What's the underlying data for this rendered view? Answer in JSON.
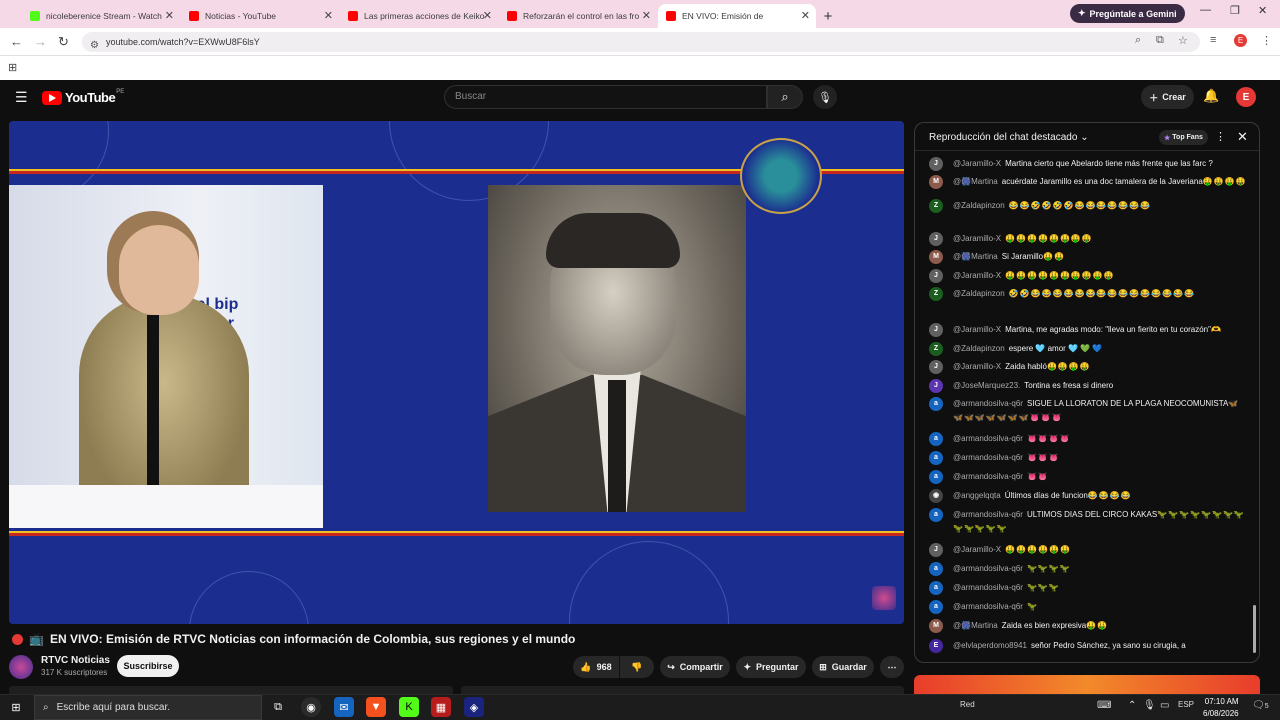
{
  "browser": {
    "tabs": [
      {
        "title": "nicoleberenice Stream - Watch",
        "color": "#53fc18"
      },
      {
        "title": "Noticias - YouTube",
        "color": "#ff0000"
      },
      {
        "title": "Las primeras acciones de Keiko",
        "color": "#ff0000"
      },
      {
        "title": "Reforzarán el control en las fro",
        "color": "#ff0000"
      },
      {
        "title": "EN VIVO: Emisión de",
        "color": "#ff0000"
      }
    ],
    "gemini": "Pregúntale a Gemini",
    "url": "youtube.com/watch?v=EXWwU8F6lsY",
    "profile": "E"
  },
  "youtube": {
    "logo": "YouTube",
    "region": "PE",
    "search_placeholder": "Buscar",
    "create": "Crear",
    "avatar": "E",
    "video": {
      "wall_text_1": "Del bip",
      "wall_text_2": "al Frer",
      "title": "EN VIVO: Emisión de RTVC Noticias con información de Colombia, sus regiones y el mundo",
      "channel": "RTVC Noticias",
      "subscribers": "317 K suscriptores",
      "subscribe": "Suscribirse",
      "likes": "968",
      "share": "Compartir",
      "ask": "Preguntar",
      "save": "Guardar"
    }
  },
  "chat": {
    "title": "Reproducción del chat destacado",
    "top_fans": "Top Fans",
    "messages": [
      {
        "initial": "J",
        "color": "#606060",
        "author": "@Jaramillo-X",
        "text": "Martina cierto que Abelardo tiene más frente que las farc ?",
        "emoji": ""
      },
      {
        "initial": "M",
        "color": "#8d5b4c",
        "author": "@🎆Martina",
        "text": "acuérdate Jaramillo es una doc tamalera de la Javeriana",
        "emoji": "🤑🤑🤑🤑"
      },
      {
        "initial": "Z",
        "color": "#1b5e20",
        "author": "@Zaldapinzon",
        "text": "",
        "emoji": "😂😂🤣🤣🤣🤣😂😂😂😂😂😂😂"
      },
      {
        "initial": "J",
        "color": "#606060",
        "author": "@Jaramillo-X",
        "text": "",
        "emoji": "🤑🤑🤑🤑🤑🤑🤑🤑"
      },
      {
        "initial": "M",
        "color": "#8d5b4c",
        "author": "@🎆Martina",
        "text": "Si Jaramillo",
        "emoji": "🤑🤑"
      },
      {
        "initial": "J",
        "color": "#606060",
        "author": "@Jaramillo-X",
        "text": "",
        "emoji": "🤑🤑🤑🤑🤑🤑🤑🤑🤑🤑"
      },
      {
        "initial": "Z",
        "color": "#1b5e20",
        "author": "@Zaldapinzon",
        "text": "",
        "emoji": "🤣🤣😂😂😂😂😂😂😂😂😂😂😂😂😂😂😂"
      },
      {
        "initial": "J",
        "color": "#606060",
        "author": "@Jaramillo-X",
        "text": "Martina, me agradas modo: \"lleva un fierito en tu corazón\"",
        "emoji": "🫶"
      },
      {
        "initial": "Z",
        "color": "#1b5e20",
        "author": "@Zaldapinzon",
        "text": "espere 🩵 amor 🩵 💚 💙",
        "emoji": ""
      },
      {
        "initial": "J",
        "color": "#606060",
        "author": "@Jaramillo-X",
        "text": "Zaida habló",
        "emoji": "🤑🤑🤑🤑"
      },
      {
        "initial": "J",
        "color": "#5e35b1",
        "author": "@JoseMarquez23.",
        "text": "Tontina es fresa si dinero",
        "emoji": ""
      },
      {
        "initial": "a",
        "color": "#1565c0",
        "author": "@armandosilva-q6r",
        "text": "SIGUE LA LLORATON DE LA PLAGA NEOCOMUNISTA",
        "emoji": "🦋🦋🦋🦋🦋🦋🦋🦋👅👅👅"
      },
      {
        "initial": "a",
        "color": "#1565c0",
        "author": "@armandosilva-q6r",
        "text": "",
        "emoji": "👅👅👅👅"
      },
      {
        "initial": "a",
        "color": "#1565c0",
        "author": "@armandosilva-q6r",
        "text": "",
        "emoji": "👅👅👅"
      },
      {
        "initial": "a",
        "color": "#1565c0",
        "author": "@armandosilva-q6r",
        "text": "",
        "emoji": "👅👅"
      },
      {
        "initial": "◉",
        "color": "#444444",
        "author": "@anggelqqta",
        "text": "Últimos días de funcion",
        "emoji": "😂😂😂😂"
      },
      {
        "initial": "a",
        "color": "#1565c0",
        "author": "@armandosilva-q6r",
        "text": "ULTIMOS DIAS DEL CIRCO KAKAS",
        "emoji": "🦖🦖🦖🦖🦖🦖🦖🦖🦖🦖🦖🦖🦖"
      },
      {
        "initial": "J",
        "color": "#606060",
        "author": "@Jaramillo-X",
        "text": "",
        "emoji": "🤑🤑🤑🤑🤑🤑"
      },
      {
        "initial": "a",
        "color": "#1565c0",
        "author": "@armandosilva-q6r",
        "text": "",
        "emoji": "🦖🦖🦖🦖"
      },
      {
        "initial": "a",
        "color": "#1565c0",
        "author": "@armandosilva-q6r",
        "text": "",
        "emoji": "🦖🦖🦖"
      },
      {
        "initial": "a",
        "color": "#1565c0",
        "author": "@armandosilva-q6r",
        "text": "",
        "emoji": "🦖"
      },
      {
        "initial": "M",
        "color": "#8d5b4c",
        "author": "@🎆Martina",
        "text": "Zaida es bien expresiva",
        "emoji": "🤑🤑"
      },
      {
        "initial": "E",
        "color": "#4527a0",
        "author": "@elvlaperdomo8941",
        "text": "señor Pedro Sánchez, ya sano su cirugia, a",
        "emoji": ""
      }
    ]
  },
  "taskbar": {
    "search": "Escribe aquí para buscar.",
    "network": "Red",
    "lang": "ESP",
    "time": "07:10 AM",
    "date": "6/08/2026",
    "notifications": "5"
  }
}
